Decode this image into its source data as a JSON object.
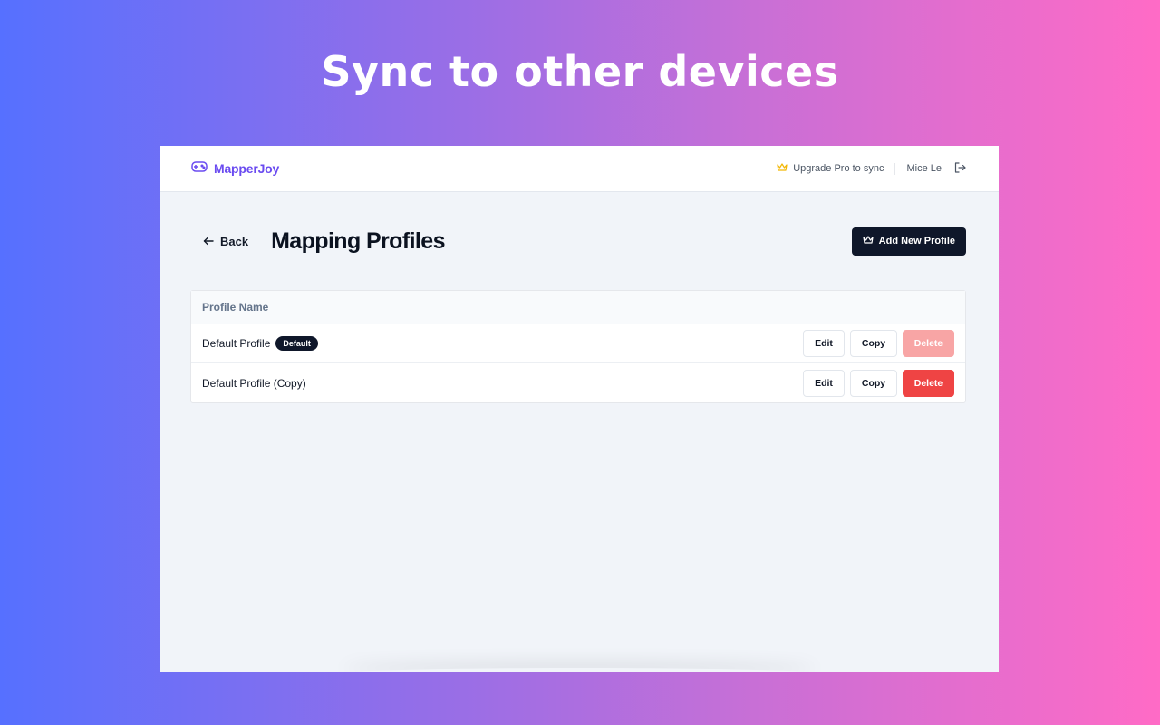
{
  "promo": {
    "title": "Sync to other devices"
  },
  "header": {
    "brand": "MapperJoy",
    "upgrade_label": "Upgrade Pro to sync",
    "user_name": "Mice Le"
  },
  "page": {
    "back_label": "Back",
    "title": "Mapping Profiles",
    "add_button_label": "Add New Profile"
  },
  "table": {
    "column_header": "Profile Name",
    "rows": [
      {
        "name": "Default Profile",
        "badge": "Default",
        "edit": "Edit",
        "copy": "Copy",
        "delete": "Delete",
        "delete_disabled": true
      },
      {
        "name": "Default Profile (Copy)",
        "badge": "",
        "edit": "Edit",
        "copy": "Copy",
        "delete": "Delete",
        "delete_disabled": false
      }
    ]
  },
  "colors": {
    "brand": "#6a4bf0",
    "primary_dark": "#0f172a",
    "danger": "#ef4444",
    "danger_disabled": "#f8a5a5",
    "crown": "#f2b705"
  },
  "icons": {
    "brand": "gamepad-icon",
    "upgrade": "crown-icon",
    "logout": "logout-icon",
    "back": "arrow-left-icon",
    "add": "crown-icon"
  }
}
